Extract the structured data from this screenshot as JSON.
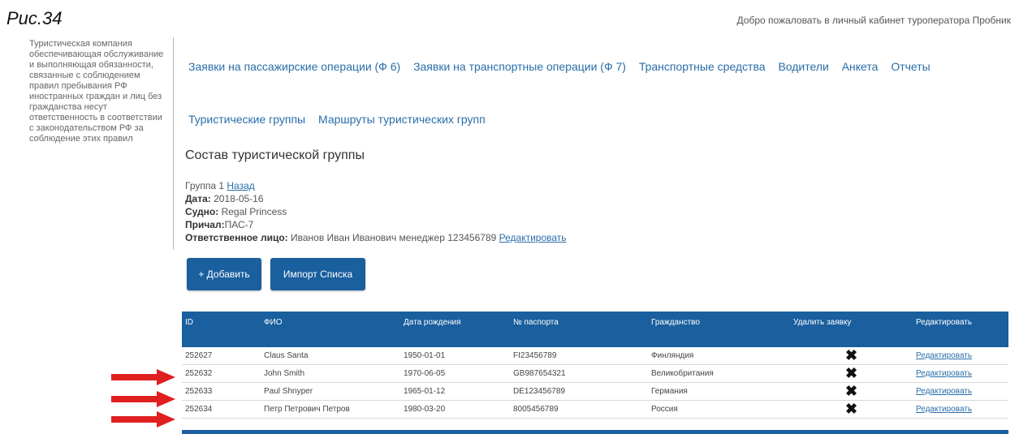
{
  "figure_caption": "Рис.34",
  "welcome_text": "Добро пожаловать в личный кабинет туроператора Пробник",
  "sidebar_text": "Туристическая компания обеспечивающая обслуживание и выполняющая обязанности, связанные с соблюдением правил пребывания РФ иностранных граждан и лиц без гражданства несут ответственность в соответствии с законодательством РФ за соблюдение этих правил",
  "nav": {
    "main": [
      "Заявки на пассажирские операции (Ф 6)",
      "Заявки на транспортные операции (Ф 7)",
      "Транспортные средства",
      "Водители",
      "Анкета",
      "Отчеты"
    ],
    "sub": [
      "Туристические группы",
      "Маршруты туристических групп"
    ]
  },
  "section_title": "Состав туристической группы",
  "group_info": {
    "group_label": "Группа 1",
    "back_link": "Назад",
    "date_label": "Дата:",
    "date_value": "2018-05-16",
    "ship_label": "Судно:",
    "ship_value": "Regal Princess",
    "berth_label": "Причал:",
    "berth_value": "ПАС-7",
    "responsible_label": "Ответственное лицо:",
    "responsible_value": "Иванов Иван Иванович менеджер 123456789",
    "edit_link": "Редактировать"
  },
  "buttons": {
    "add": "+ Добавить",
    "import": "Импорт Списка"
  },
  "table": {
    "headers": [
      "ID",
      "ФИО",
      "Дата рождения",
      "№ паспорта",
      "Гражданство",
      "Удалить заявку",
      "Редактировать"
    ],
    "rows": [
      {
        "id": "252627",
        "name": "Claus Santa",
        "birth": "1950-01-01",
        "passport": "FI23456789",
        "citizenship": "Финляндия",
        "edit": "Редактировать"
      },
      {
        "id": "252632",
        "name": "John Smith",
        "birth": "1970-06-05",
        "passport": "GB987654321",
        "citizenship": "Великобритания",
        "edit": "Редактировать"
      },
      {
        "id": "252633",
        "name": "Paul Shnyper",
        "birth": "1965-01-12",
        "passport": "DE123456789",
        "citizenship": "Германия",
        "edit": "Редактировать"
      },
      {
        "id": "252634",
        "name": "Петр Петрович Петров",
        "birth": "1980-03-20",
        "passport": "8005456789",
        "citizenship": "Россия",
        "edit": "Редактировать"
      }
    ]
  },
  "colors": {
    "accent": "#1a5f9e",
    "link": "#2a6ea8",
    "arrow": "#e02020"
  }
}
